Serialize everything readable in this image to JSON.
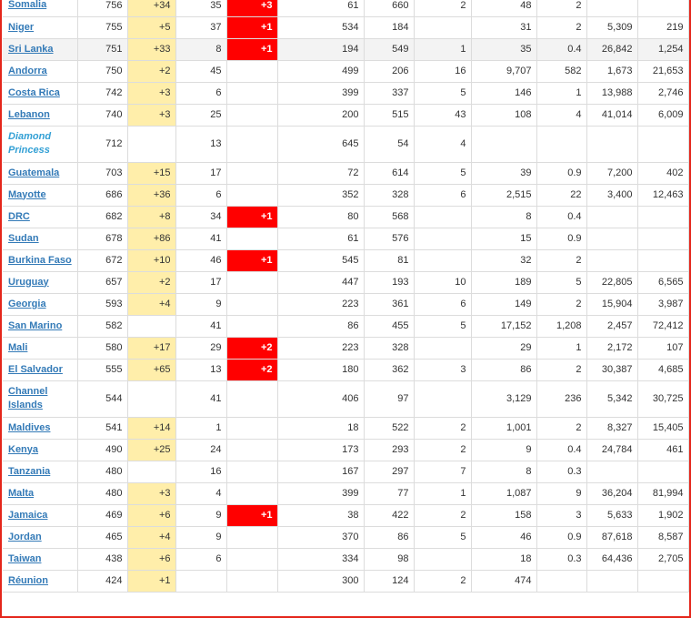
{
  "table": {
    "rows": [
      {
        "country": "Somalia",
        "link": true,
        "total": "756",
        "new_cases": "+34",
        "deaths": "35",
        "new_deaths": "+3",
        "recovered": "61",
        "active": "660",
        "serious": "2",
        "tot_per_m": "48",
        "deaths_per_m": "2",
        "tests": "",
        "tests_per_m": ""
      },
      {
        "country": "Niger",
        "link": true,
        "total": "755",
        "new_cases": "+5",
        "deaths": "37",
        "new_deaths": "+1",
        "recovered": "534",
        "active": "184",
        "serious": "",
        "tot_per_m": "31",
        "deaths_per_m": "2",
        "tests": "5,309",
        "tests_per_m": "219"
      },
      {
        "country": "Sri Lanka",
        "link": true,
        "total": "751",
        "new_cases": "+33",
        "deaths": "8",
        "new_deaths": "+1",
        "recovered": "194",
        "active": "549",
        "serious": "1",
        "tot_per_m": "35",
        "deaths_per_m": "0.4",
        "tests": "26,842",
        "tests_per_m": "1,254",
        "alt": true
      },
      {
        "country": "Andorra",
        "link": true,
        "total": "750",
        "new_cases": "+2",
        "deaths": "45",
        "new_deaths": "",
        "recovered": "499",
        "active": "206",
        "serious": "16",
        "tot_per_m": "9,707",
        "deaths_per_m": "582",
        "tests": "1,673",
        "tests_per_m": "21,653"
      },
      {
        "country": "Costa Rica",
        "link": true,
        "total": "742",
        "new_cases": "+3",
        "deaths": "6",
        "new_deaths": "",
        "recovered": "399",
        "active": "337",
        "serious": "5",
        "tot_per_m": "146",
        "deaths_per_m": "1",
        "tests": "13,988",
        "tests_per_m": "2,746"
      },
      {
        "country": "Lebanon",
        "link": true,
        "total": "740",
        "new_cases": "+3",
        "deaths": "25",
        "new_deaths": "",
        "recovered": "200",
        "active": "515",
        "serious": "43",
        "tot_per_m": "108",
        "deaths_per_m": "4",
        "tests": "41,014",
        "tests_per_m": "6,009"
      },
      {
        "country": "Diamond Princess",
        "link": false,
        "total": "712",
        "new_cases": "",
        "deaths": "13",
        "new_deaths": "",
        "recovered": "645",
        "active": "54",
        "serious": "4",
        "tot_per_m": "",
        "deaths_per_m": "",
        "tests": "",
        "tests_per_m": "",
        "tall": true
      },
      {
        "country": "Guatemala",
        "link": true,
        "total": "703",
        "new_cases": "+15",
        "deaths": "17",
        "new_deaths": "",
        "recovered": "72",
        "active": "614",
        "serious": "5",
        "tot_per_m": "39",
        "deaths_per_m": "0.9",
        "tests": "7,200",
        "tests_per_m": "402"
      },
      {
        "country": "Mayotte",
        "link": true,
        "total": "686",
        "new_cases": "+36",
        "deaths": "6",
        "new_deaths": "",
        "recovered": "352",
        "active": "328",
        "serious": "6",
        "tot_per_m": "2,515",
        "deaths_per_m": "22",
        "tests": "3,400",
        "tests_per_m": "12,463"
      },
      {
        "country": "DRC",
        "link": true,
        "total": "682",
        "new_cases": "+8",
        "deaths": "34",
        "new_deaths": "+1",
        "recovered": "80",
        "active": "568",
        "serious": "",
        "tot_per_m": "8",
        "deaths_per_m": "0.4",
        "tests": "",
        "tests_per_m": ""
      },
      {
        "country": "Sudan",
        "link": true,
        "total": "678",
        "new_cases": "+86",
        "deaths": "41",
        "new_deaths": "",
        "recovered": "61",
        "active": "576",
        "serious": "",
        "tot_per_m": "15",
        "deaths_per_m": "0.9",
        "tests": "",
        "tests_per_m": ""
      },
      {
        "country": "Burkina Faso",
        "link": true,
        "total": "672",
        "new_cases": "+10",
        "deaths": "46",
        "new_deaths": "+1",
        "recovered": "545",
        "active": "81",
        "serious": "",
        "tot_per_m": "32",
        "deaths_per_m": "2",
        "tests": "",
        "tests_per_m": ""
      },
      {
        "country": "Uruguay",
        "link": true,
        "total": "657",
        "new_cases": "+2",
        "deaths": "17",
        "new_deaths": "",
        "recovered": "447",
        "active": "193",
        "serious": "10",
        "tot_per_m": "189",
        "deaths_per_m": "5",
        "tests": "22,805",
        "tests_per_m": "6,565"
      },
      {
        "country": "Georgia",
        "link": true,
        "total": "593",
        "new_cases": "+4",
        "deaths": "9",
        "new_deaths": "",
        "recovered": "223",
        "active": "361",
        "serious": "6",
        "tot_per_m": "149",
        "deaths_per_m": "2",
        "tests": "15,904",
        "tests_per_m": "3,987"
      },
      {
        "country": "San Marino",
        "link": true,
        "total": "582",
        "new_cases": "",
        "deaths": "41",
        "new_deaths": "",
        "recovered": "86",
        "active": "455",
        "serious": "5",
        "tot_per_m": "17,152",
        "deaths_per_m": "1,208",
        "tests": "2,457",
        "tests_per_m": "72,412"
      },
      {
        "country": "Mali",
        "link": true,
        "total": "580",
        "new_cases": "+17",
        "deaths": "29",
        "new_deaths": "+2",
        "recovered": "223",
        "active": "328",
        "serious": "",
        "tot_per_m": "29",
        "deaths_per_m": "1",
        "tests": "2,172",
        "tests_per_m": "107"
      },
      {
        "country": "El Salvador",
        "link": true,
        "total": "555",
        "new_cases": "+65",
        "deaths": "13",
        "new_deaths": "+2",
        "recovered": "180",
        "active": "362",
        "serious": "3",
        "tot_per_m": "86",
        "deaths_per_m": "2",
        "tests": "30,387",
        "tests_per_m": "4,685"
      },
      {
        "country": "Channel Islands",
        "link": true,
        "total": "544",
        "new_cases": "",
        "deaths": "41",
        "new_deaths": "",
        "recovered": "406",
        "active": "97",
        "serious": "",
        "tot_per_m": "3,129",
        "deaths_per_m": "236",
        "tests": "5,342",
        "tests_per_m": "30,725",
        "tall": true
      },
      {
        "country": "Maldives",
        "link": true,
        "total": "541",
        "new_cases": "+14",
        "deaths": "1",
        "new_deaths": "",
        "recovered": "18",
        "active": "522",
        "serious": "2",
        "tot_per_m": "1,001",
        "deaths_per_m": "2",
        "tests": "8,327",
        "tests_per_m": "15,405"
      },
      {
        "country": "Kenya",
        "link": true,
        "total": "490",
        "new_cases": "+25",
        "deaths": "24",
        "new_deaths": "",
        "recovered": "173",
        "active": "293",
        "serious": "2",
        "tot_per_m": "9",
        "deaths_per_m": "0.4",
        "tests": "24,784",
        "tests_per_m": "461"
      },
      {
        "country": "Tanzania",
        "link": true,
        "total": "480",
        "new_cases": "",
        "deaths": "16",
        "new_deaths": "",
        "recovered": "167",
        "active": "297",
        "serious": "7",
        "tot_per_m": "8",
        "deaths_per_m": "0.3",
        "tests": "",
        "tests_per_m": ""
      },
      {
        "country": "Malta",
        "link": true,
        "total": "480",
        "new_cases": "+3",
        "deaths": "4",
        "new_deaths": "",
        "recovered": "399",
        "active": "77",
        "serious": "1",
        "tot_per_m": "1,087",
        "deaths_per_m": "9",
        "tests": "36,204",
        "tests_per_m": "81,994"
      },
      {
        "country": "Jamaica",
        "link": true,
        "total": "469",
        "new_cases": "+6",
        "deaths": "9",
        "new_deaths": "+1",
        "recovered": "38",
        "active": "422",
        "serious": "2",
        "tot_per_m": "158",
        "deaths_per_m": "3",
        "tests": "5,633",
        "tests_per_m": "1,902"
      },
      {
        "country": "Jordan",
        "link": true,
        "total": "465",
        "new_cases": "+4",
        "deaths": "9",
        "new_deaths": "",
        "recovered": "370",
        "active": "86",
        "serious": "5",
        "tot_per_m": "46",
        "deaths_per_m": "0.9",
        "tests": "87,618",
        "tests_per_m": "8,587"
      },
      {
        "country": "Taiwan",
        "link": true,
        "total": "438",
        "new_cases": "+6",
        "deaths": "6",
        "new_deaths": "",
        "recovered": "334",
        "active": "98",
        "serious": "",
        "tot_per_m": "18",
        "deaths_per_m": "0.3",
        "tests": "64,436",
        "tests_per_m": "2,705"
      },
      {
        "country": "Réunion",
        "link": true,
        "total": "424",
        "new_cases": "+1",
        "deaths": "",
        "new_deaths": "",
        "recovered": "300",
        "active": "124",
        "serious": "2",
        "tot_per_m": "474",
        "deaths_per_m": "",
        "tests": "",
        "tests_per_m": ""
      }
    ]
  }
}
